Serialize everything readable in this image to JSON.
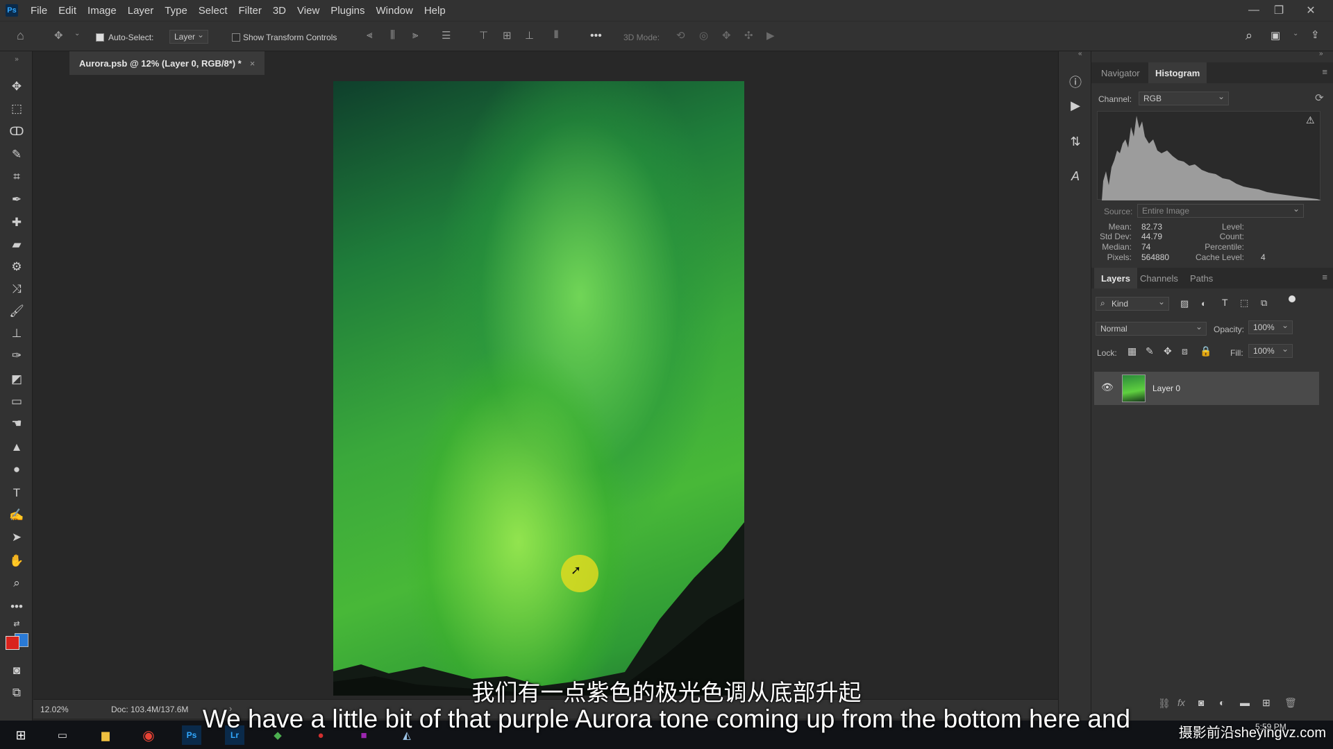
{
  "app": {
    "logo": "Ps"
  },
  "menu": [
    "File",
    "Edit",
    "Image",
    "Layer",
    "Type",
    "Select",
    "Filter",
    "3D",
    "View",
    "Plugins",
    "Window",
    "Help"
  ],
  "window_controls": {
    "minimize": "—",
    "restore": "❐",
    "close": "✕"
  },
  "options_bar": {
    "auto_select_label": "Auto-Select:",
    "auto_select_checked": true,
    "auto_select_target": "Layer",
    "show_transform_label": "Show Transform Controls",
    "show_transform_checked": false,
    "more": "•••",
    "mode_3d_label": "3D Mode:"
  },
  "document": {
    "tab_title": "Aurora.psb @ 12% (Layer 0, RGB/8*) *",
    "tab_close": "×",
    "zoom": "12.02%",
    "doc_size": "Doc: 103.4M/137.6M",
    "arrow": "›"
  },
  "histogram_panel": {
    "tabs": [
      "Navigator",
      "Histogram"
    ],
    "active_tab": "Histogram",
    "channel_label": "Channel:",
    "channel_value": "RGB",
    "source_label": "Source:",
    "source_value": "Entire Image",
    "stats_left": [
      {
        "label": "Mean:",
        "value": "82.73"
      },
      {
        "label": "Std Dev:",
        "value": "44.79"
      },
      {
        "label": "Median:",
        "value": "74"
      },
      {
        "label": "Pixels:",
        "value": "564880"
      }
    ],
    "stats_right": [
      {
        "label": "Level:",
        "value": ""
      },
      {
        "label": "Count:",
        "value": ""
      },
      {
        "label": "Percentile:",
        "value": ""
      },
      {
        "label": "Cache Level:",
        "value": "4"
      }
    ]
  },
  "layers_panel": {
    "tabs": [
      "Layers",
      "Channels",
      "Paths"
    ],
    "active_tab": "Layers",
    "kind_label": "Kind",
    "blend_mode": "Normal",
    "opacity_label": "Opacity:",
    "opacity_value": "100%",
    "lock_label": "Lock:",
    "fill_label": "Fill:",
    "fill_value": "100%",
    "layers": [
      {
        "name": "Layer 0",
        "visible": true
      }
    ],
    "bottom_icons": [
      "link-icon",
      "fx-icon",
      "mask-icon",
      "adjustment-icon",
      "group-icon",
      "new-layer-icon",
      "trash-icon"
    ],
    "fx_label": "fx"
  },
  "subtitles": {
    "chinese": "我们有一点紫色的极光色调从底部升起",
    "english": "We have a little bit of that purple Aurora tone coming up from the bottom here and"
  },
  "watermark": "摄影前沿sheyingvz.com",
  "taskbar": {
    "time": "5:59 PM",
    "icons": [
      "windows-start-icon",
      "task-view-icon",
      "file-explorer-icon",
      "chrome-icon",
      "photoshop-icon",
      "lightroom-icon",
      "app-icon",
      "app-icon",
      "app-icon",
      "app-icon"
    ]
  },
  "colors": {
    "foreground": "#d9231c",
    "background": "#2a7ad6",
    "accent_cursor": "#e6dc1e"
  }
}
